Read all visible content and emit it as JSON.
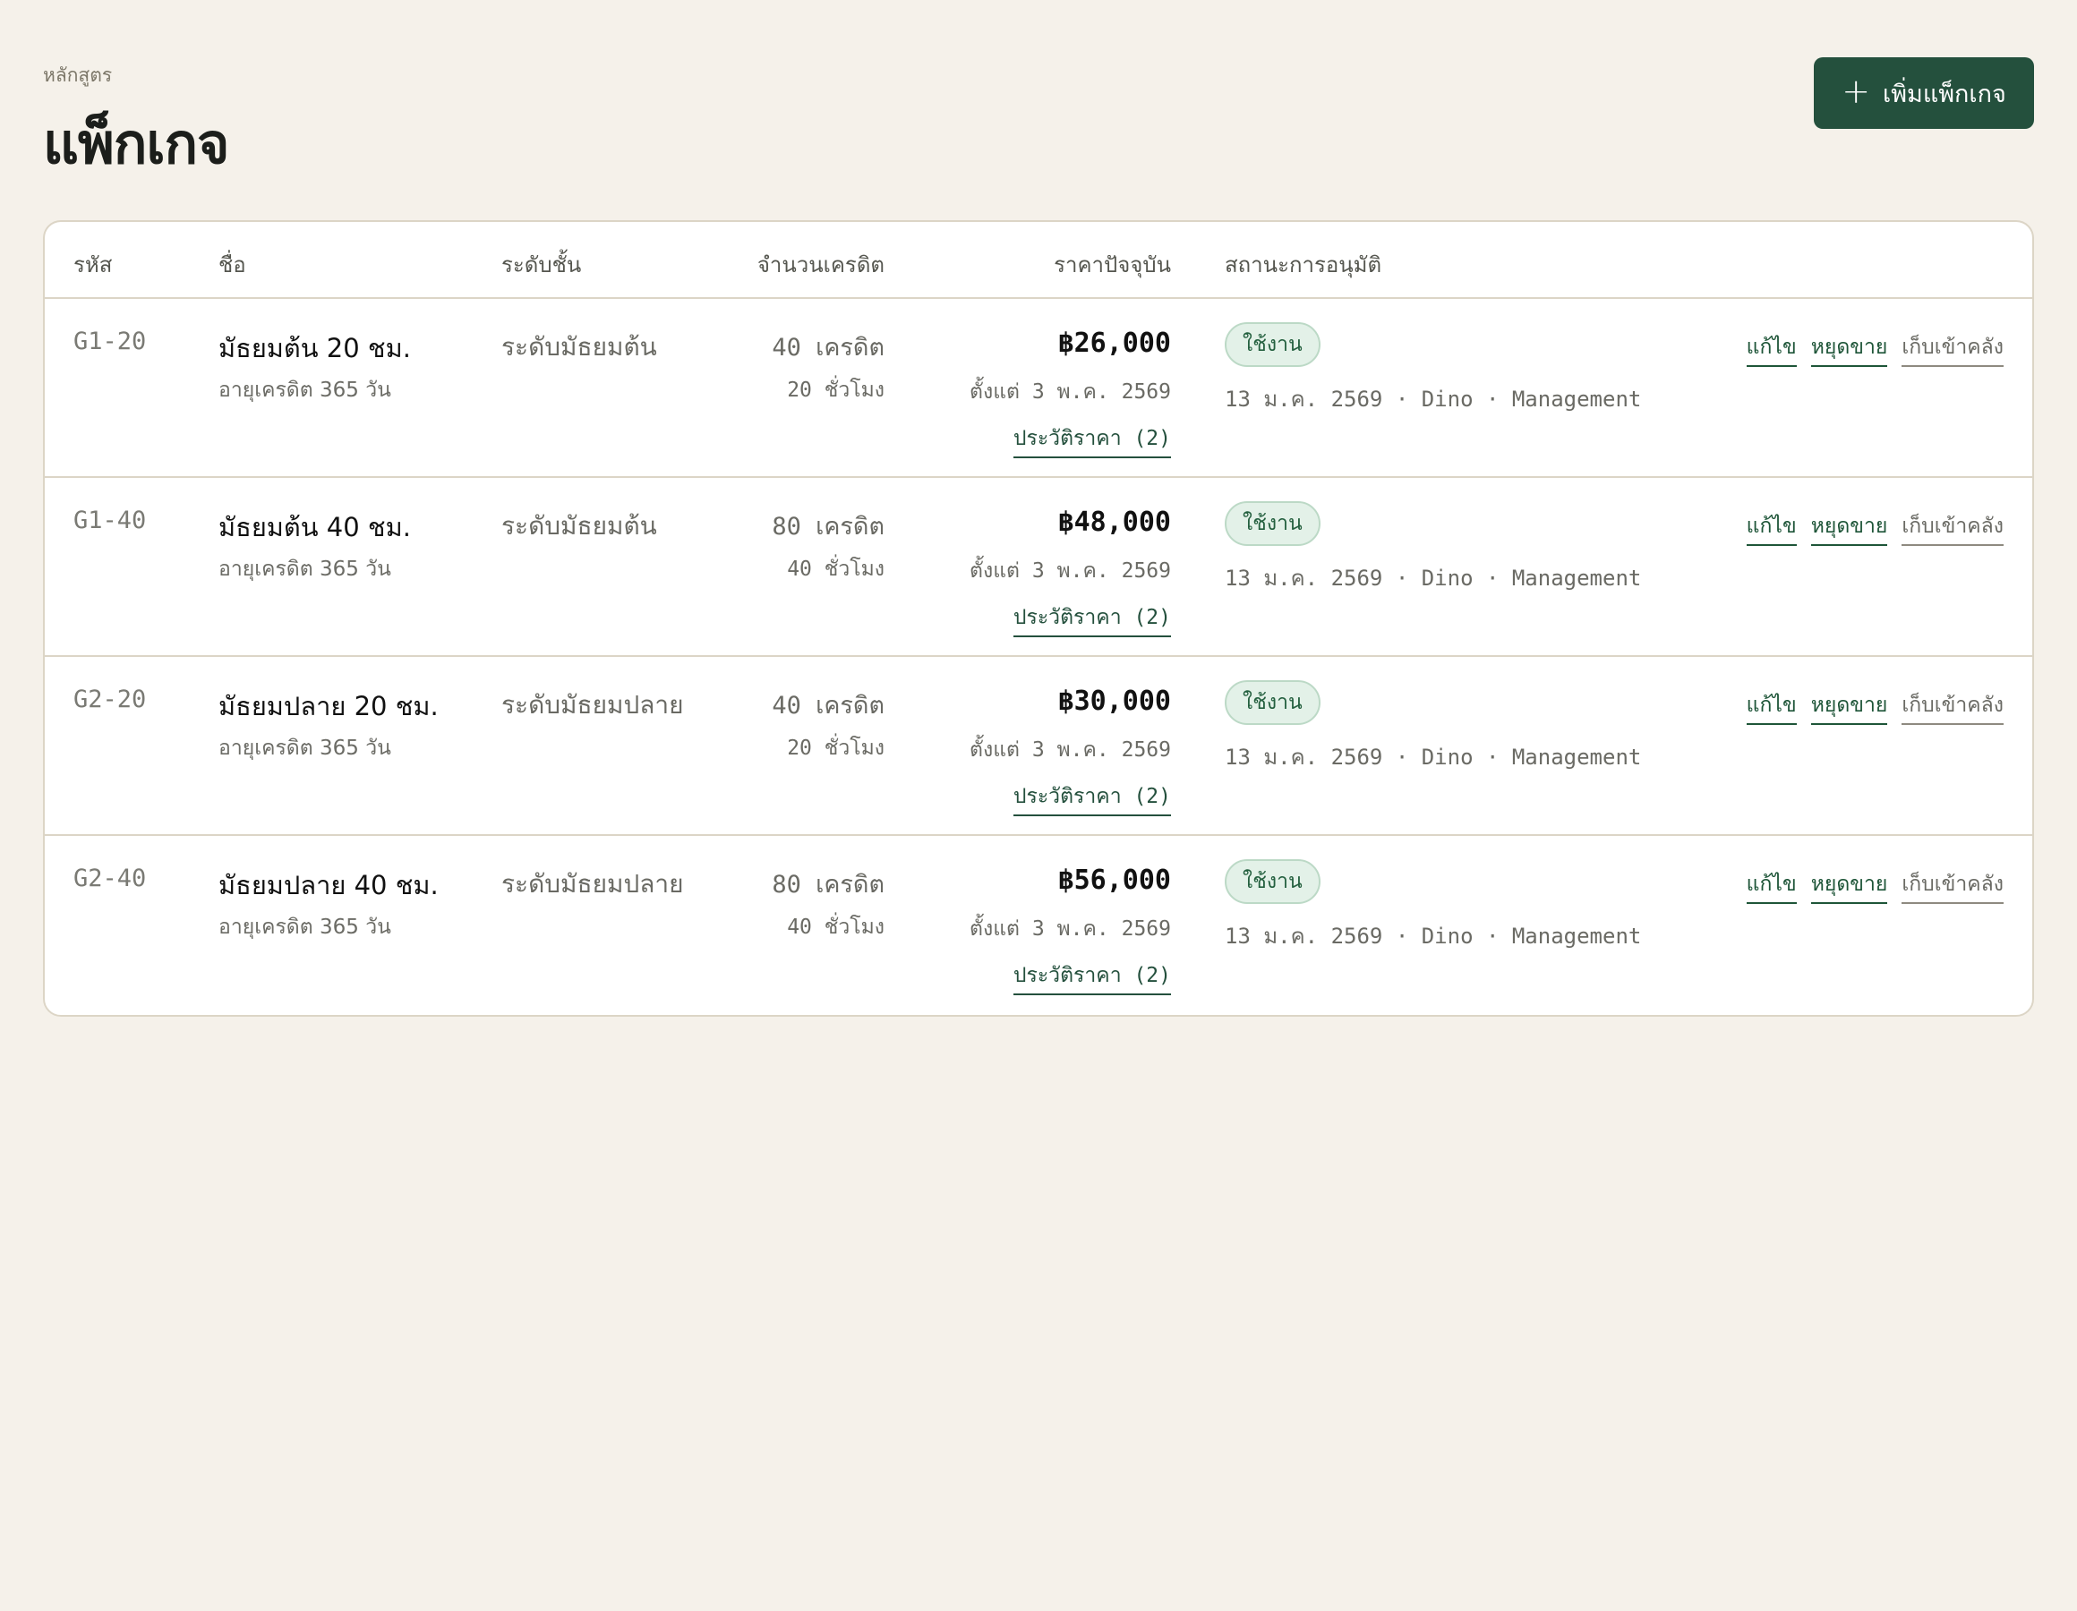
{
  "header": {
    "breadcrumb": "หลักสูตร",
    "title": "แพ็กเกจ",
    "add_button": {
      "icon": "plus-icon",
      "label": "เพิ่มแพ็กเกจ"
    }
  },
  "table": {
    "columns": [
      "รหัส",
      "ชื่อ",
      "ระดับชั้น",
      "จำนวนเครดิต",
      "ราคาปัจจุบัน",
      "สถานะการอนุมัติ"
    ],
    "rows": [
      {
        "code": "G1-20",
        "name": "มัธยมต้น 20 ชม.",
        "validity": "อายุเครดิต 365 วัน",
        "level": "ระดับมัธยมต้น",
        "credits": "40 เครดิต",
        "hours": "20 ชั่วโมง",
        "price": "฿26,000",
        "since": "ตั้งแต่ 3 พ.ค. 2569",
        "history": "ประวัติราคา (2)",
        "status": "ใช้งาน",
        "approval": "13 ม.ค. 2569 · Dino · Management",
        "actions": {
          "edit": "แก้ไข",
          "stop": "หยุดขาย",
          "archive": "เก็บเข้าคลัง"
        }
      },
      {
        "code": "G1-40",
        "name": "มัธยมต้น 40 ชม.",
        "validity": "อายุเครดิต 365 วัน",
        "level": "ระดับมัธยมต้น",
        "credits": "80 เครดิต",
        "hours": "40 ชั่วโมง",
        "price": "฿48,000",
        "since": "ตั้งแต่ 3 พ.ค. 2569",
        "history": "ประวัติราคา (2)",
        "status": "ใช้งาน",
        "approval": "13 ม.ค. 2569 · Dino · Management",
        "actions": {
          "edit": "แก้ไข",
          "stop": "หยุดขาย",
          "archive": "เก็บเข้าคลัง"
        }
      },
      {
        "code": "G2-20",
        "name": "มัธยมปลาย 20 ชม.",
        "validity": "อายุเครดิต 365 วัน",
        "level": "ระดับมัธยมปลาย",
        "credits": "40 เครดิต",
        "hours": "20 ชั่วโมง",
        "price": "฿30,000",
        "since": "ตั้งแต่ 3 พ.ค. 2569",
        "history": "ประวัติราคา (2)",
        "status": "ใช้งาน",
        "approval": "13 ม.ค. 2569 · Dino · Management",
        "actions": {
          "edit": "แก้ไข",
          "stop": "หยุดขาย",
          "archive": "เก็บเข้าคลัง"
        }
      },
      {
        "code": "G2-40",
        "name": "มัธยมปลาย 40 ชม.",
        "validity": "อายุเครดิต 365 วัน",
        "level": "ระดับมัธยมปลาย",
        "credits": "80 เครดิต",
        "hours": "40 ชั่วโมง",
        "price": "฿56,000",
        "since": "ตั้งแต่ 3 พ.ค. 2569",
        "history": "ประวัติราคา (2)",
        "status": "ใช้งาน",
        "approval": "13 ม.ค. 2569 · Dino · Management",
        "actions": {
          "edit": "แก้ไข",
          "stop": "หยุดขาย",
          "archive": "เก็บเข้าคลัง"
        }
      }
    ]
  },
  "colors": {
    "background": "#f5f1ea",
    "primary": "#24503d",
    "badge_bg": "#e3f1e8",
    "border": "#dcd5c6"
  }
}
